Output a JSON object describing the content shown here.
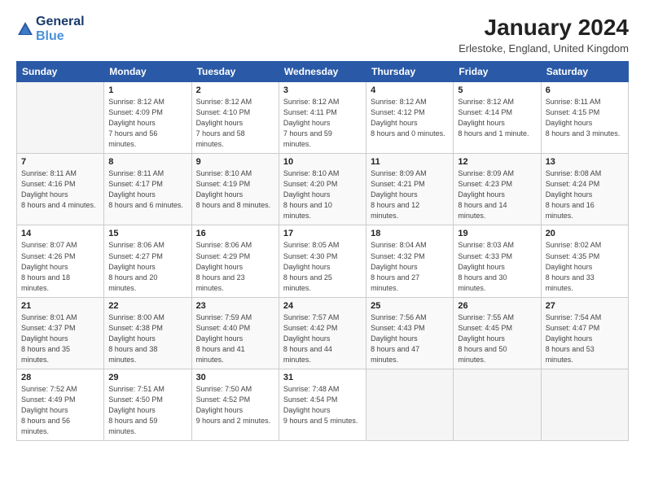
{
  "header": {
    "logo_line1": "General",
    "logo_line2": "Blue",
    "title": "January 2024",
    "subtitle": "Erlestoke, England, United Kingdom"
  },
  "weekdays": [
    "Sunday",
    "Monday",
    "Tuesday",
    "Wednesday",
    "Thursday",
    "Friday",
    "Saturday"
  ],
  "weeks": [
    [
      {
        "day": "",
        "empty": true
      },
      {
        "day": "1",
        "sunrise": "8:12 AM",
        "sunset": "4:09 PM",
        "daylight": "7 hours and 56 minutes."
      },
      {
        "day": "2",
        "sunrise": "8:12 AM",
        "sunset": "4:10 PM",
        "daylight": "7 hours and 58 minutes."
      },
      {
        "day": "3",
        "sunrise": "8:12 AM",
        "sunset": "4:11 PM",
        "daylight": "7 hours and 59 minutes."
      },
      {
        "day": "4",
        "sunrise": "8:12 AM",
        "sunset": "4:12 PM",
        "daylight": "8 hours and 0 minutes."
      },
      {
        "day": "5",
        "sunrise": "8:12 AM",
        "sunset": "4:14 PM",
        "daylight": "8 hours and 1 minute."
      },
      {
        "day": "6",
        "sunrise": "8:11 AM",
        "sunset": "4:15 PM",
        "daylight": "8 hours and 3 minutes."
      }
    ],
    [
      {
        "day": "7",
        "sunrise": "8:11 AM",
        "sunset": "4:16 PM",
        "daylight": "8 hours and 4 minutes."
      },
      {
        "day": "8",
        "sunrise": "8:11 AM",
        "sunset": "4:17 PM",
        "daylight": "8 hours and 6 minutes."
      },
      {
        "day": "9",
        "sunrise": "8:10 AM",
        "sunset": "4:19 PM",
        "daylight": "8 hours and 8 minutes."
      },
      {
        "day": "10",
        "sunrise": "8:10 AM",
        "sunset": "4:20 PM",
        "daylight": "8 hours and 10 minutes."
      },
      {
        "day": "11",
        "sunrise": "8:09 AM",
        "sunset": "4:21 PM",
        "daylight": "8 hours and 12 minutes."
      },
      {
        "day": "12",
        "sunrise": "8:09 AM",
        "sunset": "4:23 PM",
        "daylight": "8 hours and 14 minutes."
      },
      {
        "day": "13",
        "sunrise": "8:08 AM",
        "sunset": "4:24 PM",
        "daylight": "8 hours and 16 minutes."
      }
    ],
    [
      {
        "day": "14",
        "sunrise": "8:07 AM",
        "sunset": "4:26 PM",
        "daylight": "8 hours and 18 minutes."
      },
      {
        "day": "15",
        "sunrise": "8:06 AM",
        "sunset": "4:27 PM",
        "daylight": "8 hours and 20 minutes."
      },
      {
        "day": "16",
        "sunrise": "8:06 AM",
        "sunset": "4:29 PM",
        "daylight": "8 hours and 23 minutes."
      },
      {
        "day": "17",
        "sunrise": "8:05 AM",
        "sunset": "4:30 PM",
        "daylight": "8 hours and 25 minutes."
      },
      {
        "day": "18",
        "sunrise": "8:04 AM",
        "sunset": "4:32 PM",
        "daylight": "8 hours and 27 minutes."
      },
      {
        "day": "19",
        "sunrise": "8:03 AM",
        "sunset": "4:33 PM",
        "daylight": "8 hours and 30 minutes."
      },
      {
        "day": "20",
        "sunrise": "8:02 AM",
        "sunset": "4:35 PM",
        "daylight": "8 hours and 33 minutes."
      }
    ],
    [
      {
        "day": "21",
        "sunrise": "8:01 AM",
        "sunset": "4:37 PM",
        "daylight": "8 hours and 35 minutes."
      },
      {
        "day": "22",
        "sunrise": "8:00 AM",
        "sunset": "4:38 PM",
        "daylight": "8 hours and 38 minutes."
      },
      {
        "day": "23",
        "sunrise": "7:59 AM",
        "sunset": "4:40 PM",
        "daylight": "8 hours and 41 minutes."
      },
      {
        "day": "24",
        "sunrise": "7:57 AM",
        "sunset": "4:42 PM",
        "daylight": "8 hours and 44 minutes."
      },
      {
        "day": "25",
        "sunrise": "7:56 AM",
        "sunset": "4:43 PM",
        "daylight": "8 hours and 47 minutes."
      },
      {
        "day": "26",
        "sunrise": "7:55 AM",
        "sunset": "4:45 PM",
        "daylight": "8 hours and 50 minutes."
      },
      {
        "day": "27",
        "sunrise": "7:54 AM",
        "sunset": "4:47 PM",
        "daylight": "8 hours and 53 minutes."
      }
    ],
    [
      {
        "day": "28",
        "sunrise": "7:52 AM",
        "sunset": "4:49 PM",
        "daylight": "8 hours and 56 minutes."
      },
      {
        "day": "29",
        "sunrise": "7:51 AM",
        "sunset": "4:50 PM",
        "daylight": "8 hours and 59 minutes."
      },
      {
        "day": "30",
        "sunrise": "7:50 AM",
        "sunset": "4:52 PM",
        "daylight": "9 hours and 2 minutes."
      },
      {
        "day": "31",
        "sunrise": "7:48 AM",
        "sunset": "4:54 PM",
        "daylight": "9 hours and 5 minutes."
      },
      {
        "day": "",
        "empty": true
      },
      {
        "day": "",
        "empty": true
      },
      {
        "day": "",
        "empty": true
      }
    ]
  ]
}
